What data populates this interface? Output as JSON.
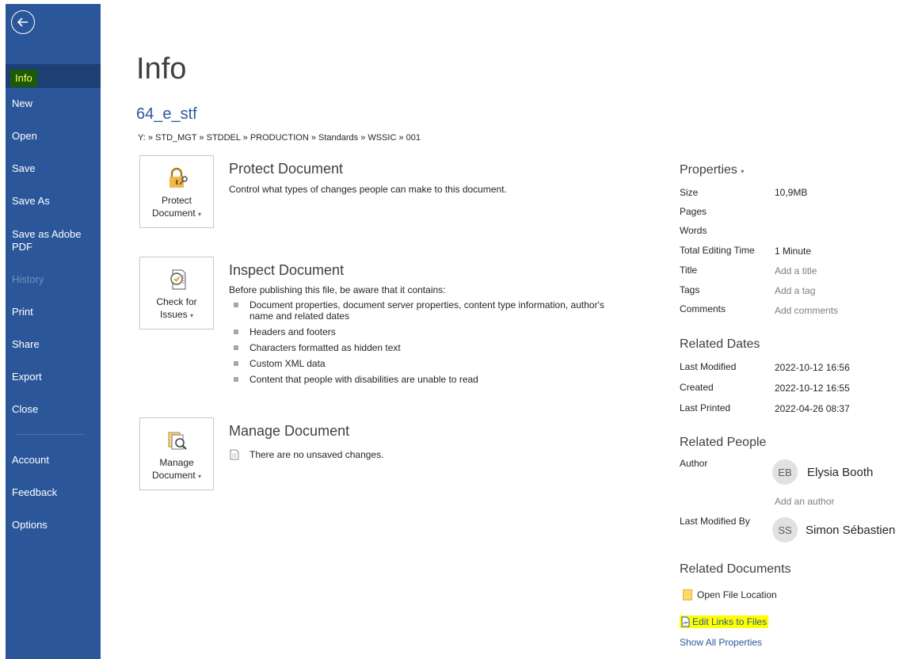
{
  "sidebar": {
    "items": [
      {
        "label": "Info",
        "active": true
      },
      {
        "label": "New"
      },
      {
        "label": "Open"
      },
      {
        "label": "Save"
      },
      {
        "label": "Save As"
      },
      {
        "label": "Save as Adobe PDF"
      },
      {
        "label": "History",
        "disabled": true
      },
      {
        "label": "Print"
      },
      {
        "label": "Share"
      },
      {
        "label": "Export"
      },
      {
        "label": "Close"
      },
      {
        "label": "Account"
      },
      {
        "label": "Feedback"
      },
      {
        "label": "Options"
      }
    ]
  },
  "page": {
    "title": "Info",
    "doc_name": "64_e_stf",
    "path": "Y: » STD_MGT » STDDEL » PRODUCTION » Standards » WSSIC » 001"
  },
  "protect": {
    "tile_line1": "Protect",
    "tile_line2": "Document",
    "title": "Protect Document",
    "desc": "Control what types of changes people can make to this document."
  },
  "inspect": {
    "tile_line1": "Check for",
    "tile_line2": "Issues",
    "title": "Inspect Document",
    "desc": "Before publishing this file, be aware that it contains:",
    "bullets": [
      "Document properties, document server properties, content type information, author's name and related dates",
      "Headers and footers",
      "Characters formatted as hidden text",
      "Custom XML data",
      "Content that people with disabilities are unable to read"
    ]
  },
  "manage": {
    "tile_line1": "Manage",
    "tile_line2": "Document",
    "title": "Manage Document",
    "desc": "There are no unsaved changes."
  },
  "properties": {
    "title": "Properties",
    "size_label": "Size",
    "size_value": "10,9MB",
    "pages_label": "Pages",
    "words_label": "Words",
    "editing_label": "Total Editing Time",
    "editing_value": "1 Minute",
    "title_label": "Title",
    "title_value": "Add a title",
    "tags_label": "Tags",
    "tags_value": "Add a tag",
    "comments_label": "Comments",
    "comments_value": "Add comments"
  },
  "dates": {
    "title": "Related Dates",
    "modified_label": "Last Modified",
    "modified_value": "2022-10-12 16:56",
    "created_label": "Created",
    "created_value": "2022-10-12 16:55",
    "printed_label": "Last Printed",
    "printed_value": "2022-04-26 08:37"
  },
  "people": {
    "title": "Related People",
    "author_label": "Author",
    "author_initials": "EB",
    "author_name": "Elysia Booth",
    "add_author": "Add an author",
    "modified_by_label": "Last Modified By",
    "modifier_initials": "SS",
    "modifier_name": "Simon Sébastien"
  },
  "documents": {
    "title": "Related Documents",
    "open_location": "Open File Location",
    "edit_links": "Edit Links to Files",
    "show_all": "Show All Properties"
  },
  "colors": {
    "sidebar": "#2b579a",
    "highlight_yellow": "#ffff00",
    "highlight_green": "#0f4d0f"
  }
}
